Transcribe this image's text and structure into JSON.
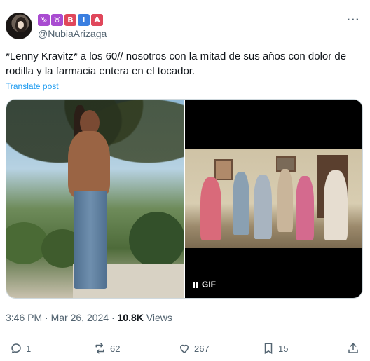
{
  "author": {
    "display_name_badges": [
      {
        "glyph": "♑",
        "color": "#a94cd1"
      },
      {
        "glyph": "♉",
        "color": "#a94cd1"
      },
      {
        "glyph": "B",
        "color": "#e0475b"
      },
      {
        "glyph": "i",
        "color": "#3b7fe0"
      },
      {
        "glyph": "A",
        "color": "#e0475b"
      }
    ],
    "handle": "@NubiaArizaga"
  },
  "more_icon": "more-horizontal-icon",
  "tweet": {
    "text": "*Lenny Kravitz* a los 60// nosotros con la mitad de sus años con dolor de rodilla y la farmacia entera en el tocador.",
    "translate_label": "Translate post"
  },
  "media": {
    "gif_label": "GIF",
    "pause_icon": "pause-icon"
  },
  "meta": {
    "time": "3:46 PM",
    "separator": " · ",
    "date": "Mar 26, 2024",
    "views_count": "10.8K",
    "views_label": " Views"
  },
  "actions": {
    "replies": "1",
    "reposts": "62",
    "likes": "267",
    "bookmarks": "15"
  },
  "colors": {
    "link": "#1d9bf0",
    "secondary_text": "#536471",
    "primary_text": "#0f1419"
  }
}
